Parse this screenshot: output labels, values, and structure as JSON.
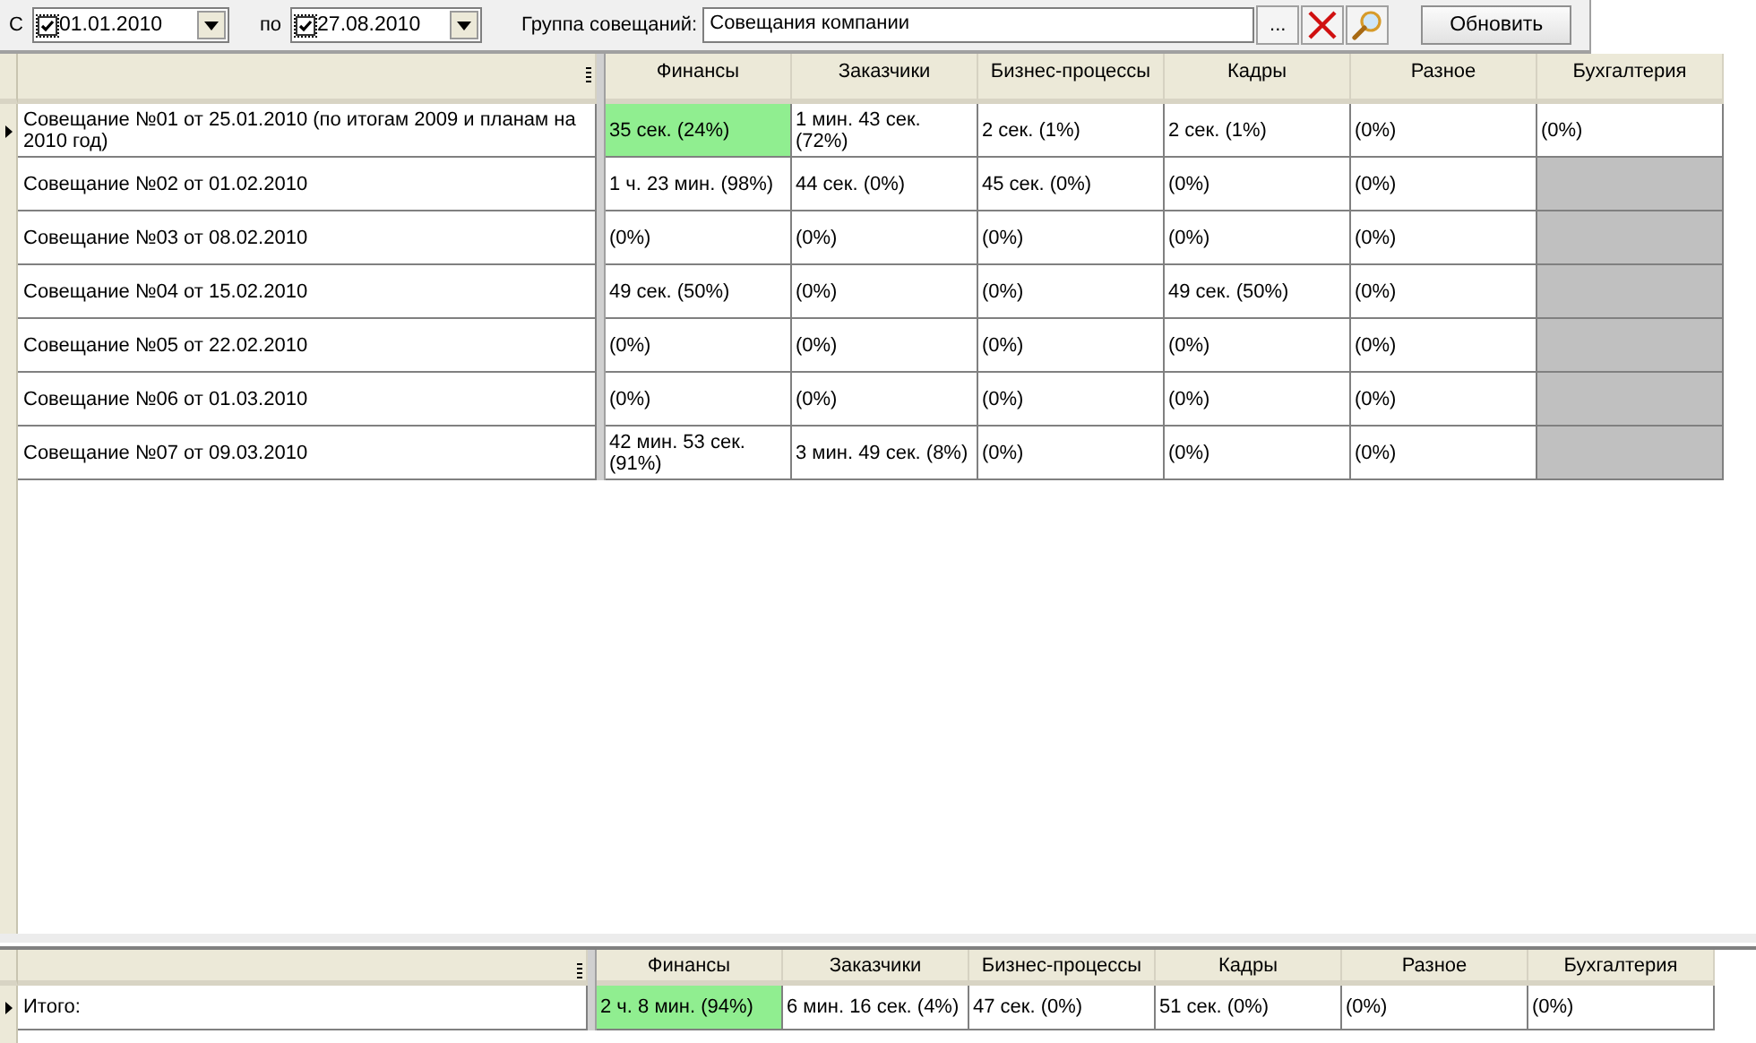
{
  "toolbar": {
    "from_label": "С",
    "from_date": {
      "checked": true,
      "value": "01.01.2010"
    },
    "to_label": "по",
    "to_date": {
      "checked": true,
      "value": "27.08.2010"
    },
    "group_label": "Группа совещаний:",
    "group_value": "Совещания компании",
    "browse_button": "...",
    "refresh_button": "Обновить"
  },
  "meetings": {
    "columns": [
      "Финансы",
      "Заказчики",
      "Бизнес-процессы",
      "Кадры",
      "Разное",
      "Бухгалтерия"
    ],
    "rows": [
      {
        "name": "Совещание №01 от 25.01.2010 (по итогам 2009 и планам на 2010 год)",
        "current": true,
        "cells": [
          {
            "text": "35 сек. (24%)",
            "color": "#90ee90"
          },
          {
            "text": "1 мин. 43 сек. (72%)"
          },
          {
            "text": "2 сек. (1%)"
          },
          {
            "text": "2 сек. (1%)"
          },
          {
            "text": "(0%)"
          },
          {
            "text": "(0%)"
          }
        ]
      },
      {
        "name": "Совещание №02 от 01.02.2010",
        "current": false,
        "cells": [
          {
            "text": "1 ч. 23 мин. (98%)"
          },
          {
            "text": "44 сек. (0%)"
          },
          {
            "text": "45 сек. (0%)"
          },
          {
            "text": "(0%)"
          },
          {
            "text": "(0%)"
          },
          {
            "color": "#c0c0c0"
          }
        ]
      },
      {
        "name": "Совещание №03 от 08.02.2010",
        "current": false,
        "cells": [
          {
            "text": "(0%)"
          },
          {
            "text": "(0%)"
          },
          {
            "text": "(0%)"
          },
          {
            "text": "(0%)"
          },
          {
            "text": "(0%)"
          },
          {
            "color": "#c0c0c0"
          }
        ]
      },
      {
        "name": "Совещание №04 от 15.02.2010",
        "current": false,
        "cells": [
          {
            "text": "49 сек. (50%)"
          },
          {
            "text": "(0%)"
          },
          {
            "text": "(0%)"
          },
          {
            "text": "49 сек. (50%)"
          },
          {
            "text": "(0%)"
          },
          {
            "color": "#c0c0c0"
          }
        ]
      },
      {
        "name": "Совещание №05 от 22.02.2010",
        "current": false,
        "cells": [
          {
            "text": "(0%)"
          },
          {
            "text": "(0%)"
          },
          {
            "text": "(0%)"
          },
          {
            "text": "(0%)"
          },
          {
            "text": "(0%)"
          },
          {
            "color": "#c0c0c0"
          }
        ]
      },
      {
        "name": "Совещание №06 от 01.03.2010",
        "current": false,
        "cells": [
          {
            "text": "(0%)"
          },
          {
            "text": "(0%)"
          },
          {
            "text": "(0%)"
          },
          {
            "text": "(0%)"
          },
          {
            "text": "(0%)"
          },
          {
            "color": "#c0c0c0"
          }
        ]
      },
      {
        "name": "Совещание №07 от 09.03.2010",
        "current": false,
        "cells": [
          {
            "text": "42 мин. 53 сек. (91%)"
          },
          {
            "text": "3 мин. 49 сек. (8%)"
          },
          {
            "text": "(0%)"
          },
          {
            "text": "(0%)"
          },
          {
            "text": "(0%)"
          },
          {
            "color": "#c0c0c0"
          }
        ]
      }
    ]
  },
  "totals": {
    "columns": [
      "Финансы",
      "Заказчики",
      "Бизнес-процессы",
      "Кадры",
      "Разное",
      "Бухгалтерия"
    ],
    "rows": [
      {
        "name": "Итого:",
        "current": true,
        "cells": [
          {
            "text": "2 ч. 8 мин. (94%)",
            "color": "#90ee90"
          },
          {
            "text": "6 мин. 16 сек. (4%)"
          },
          {
            "text": "47 сек. (0%)"
          },
          {
            "text": "51 сек. (0%)"
          },
          {
            "text": "(0%)"
          },
          {
            "text": "(0%)"
          }
        ]
      }
    ]
  }
}
